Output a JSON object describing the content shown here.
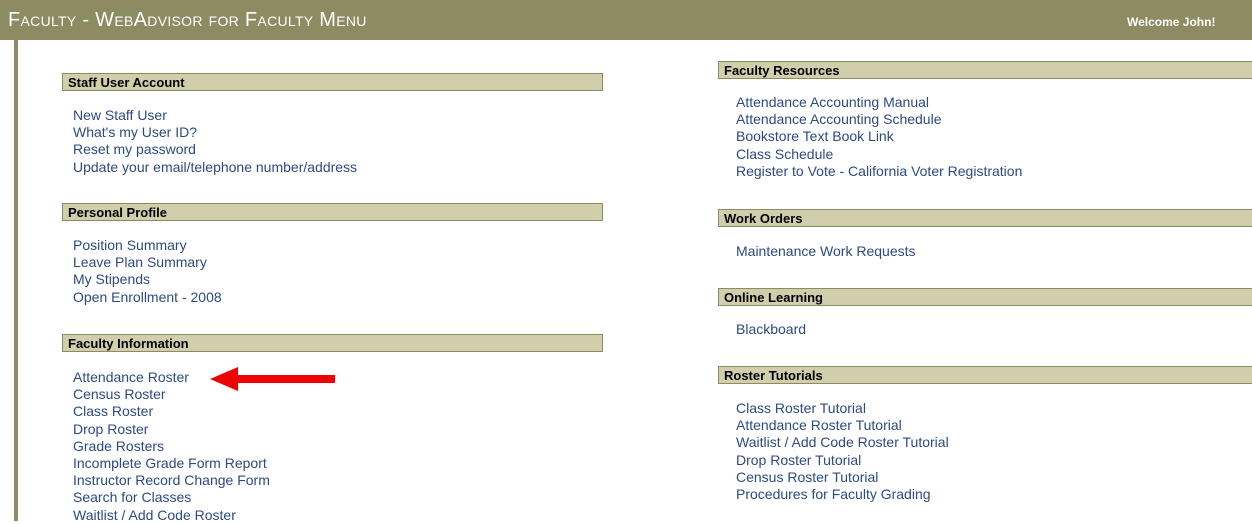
{
  "header": {
    "title": "Faculty - WebAdvisor for Faculty Menu",
    "welcome": "Welcome John!"
  },
  "left_sections": [
    {
      "title": "Staff User Account",
      "links": [
        "New Staff User",
        "What's my User ID?",
        "Reset my password",
        "Update your email/telephone number/address"
      ]
    },
    {
      "title": "Personal Profile",
      "links": [
        "Position Summary",
        "Leave Plan Summary",
        "My Stipends",
        "Open Enrollment - 2008"
      ]
    },
    {
      "title": "Faculty Information",
      "links": [
        "Attendance Roster",
        "Census Roster",
        "Class Roster",
        "Drop Roster",
        "Grade Rosters",
        "Incomplete Grade Form Report",
        "Instructor Record Change Form",
        "Search for Classes",
        "Waitlist / Add Code Roster"
      ]
    }
  ],
  "right_sections": [
    {
      "title": "Faculty Resources",
      "links": [
        "Attendance Accounting Manual",
        "Attendance Accounting Schedule",
        "Bookstore Text Book Link",
        "Class Schedule",
        "Register to Vote - California Voter Registration"
      ]
    },
    {
      "title": "Work Orders",
      "links": [
        "Maintenance Work Requests"
      ]
    },
    {
      "title": "Online Learning",
      "links": [
        "Blackboard"
      ]
    },
    {
      "title": "Roster Tutorials",
      "links": [
        "Class Roster Tutorial",
        "Attendance Roster Tutorial",
        "Waitlist / Add Code Roster Tutorial",
        "Drop Roster Tutorial",
        "Census Roster Tutorial",
        "Procedures for Faculty Grading"
      ]
    }
  ],
  "annotation": {
    "arrow_color": "#ee0000"
  }
}
